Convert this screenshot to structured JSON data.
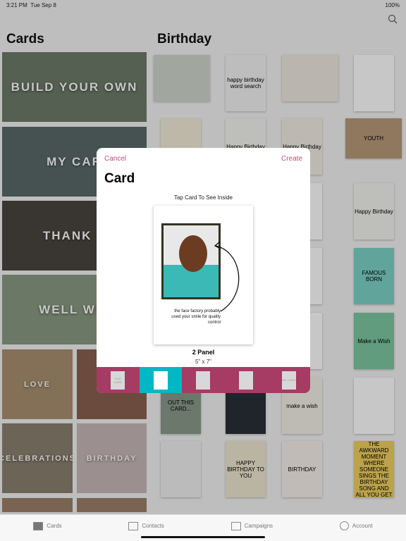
{
  "status": {
    "time": "3:21 PM",
    "date": "Tue Sep 8",
    "battery": "100%"
  },
  "sections": {
    "cards": "Cards",
    "birthday": "Birthday"
  },
  "categories": [
    {
      "label": "BUILD YOUR OWN",
      "color": "#6e7a6a"
    },
    {
      "label": "MY CAR",
      "color": "#5a6a68"
    },
    {
      "label": "THANK Y",
      "color": "#4a4640"
    },
    {
      "label": "WELL WIS",
      "color": "#8a9a82"
    },
    {
      "label": "LOVE",
      "color": "#a89070"
    },
    {
      "label": "HO",
      "color": "#8a6050"
    },
    {
      "label": "CELEBRATIONS",
      "color": "#8a8070"
    },
    {
      "label": "BIRTHDAY",
      "color": "#c8b8b8"
    }
  ],
  "thumbs": [
    "",
    "happy birthday word search",
    "",
    "",
    "",
    "Happy Birthday",
    "Happy Birthday",
    "YOUTH",
    "",
    "",
    "",
    "Happy Birthday",
    "",
    "",
    "",
    "FAMOUS BORN",
    "",
    "",
    "ppy",
    "Make a Wish",
    "OUT THIS CARD...",
    "",
    "make a wish",
    "",
    "",
    "HAPPY BIRTHDAY TO YOU",
    "BIRTHDAY",
    "I SURVIVED THE AWKWARD MOMENT WHERE SOMEONE SINGS THE BIRTHDAY SONG AND ALL YOU GET IS THIS CARD"
  ],
  "modal": {
    "cancel": "Cancel",
    "create": "Create",
    "title": "Card",
    "hint": "Tap Card To See Inside",
    "quote": "the face factory probably used your smile for quality control",
    "panel": "2 Panel",
    "size": "5\" x 7\"",
    "types": [
      {
        "name": "flat-card",
        "label": "FLAT CARD"
      },
      {
        "name": "2-panel",
        "label": "",
        "selected": true
      },
      {
        "name": "3-panel",
        "label": ""
      },
      {
        "name": "postcard",
        "label": ""
      },
      {
        "name": "big-card",
        "label": "BIG CARD"
      }
    ]
  },
  "tabs": [
    {
      "label": "Cards",
      "icon": "envelope-icon"
    },
    {
      "label": "Contacts",
      "icon": "contacts-icon"
    },
    {
      "label": "Campaigns",
      "icon": "campaigns-icon"
    },
    {
      "label": "Account",
      "icon": "account-icon"
    }
  ],
  "colors": {
    "accent": "#c44a7a",
    "typebar": "#a63b64",
    "selected": "#00b8c4"
  }
}
